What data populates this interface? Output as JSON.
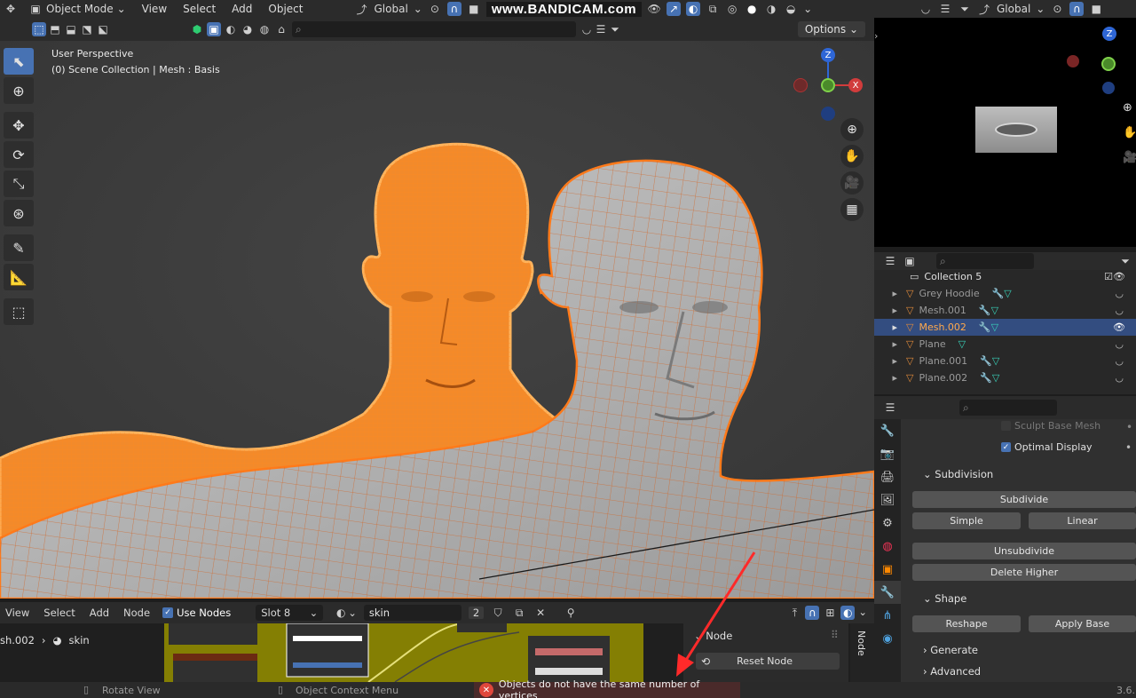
{
  "header": {
    "mode": "Object Mode",
    "menus": [
      "View",
      "Select",
      "Add",
      "Object"
    ],
    "orientation": "Global",
    "watermark": "www.BANDICAM.com",
    "options": "Options"
  },
  "viewport": {
    "perspective": "User Perspective",
    "collection_info": "(0) Scene Collection | Mesh : Basis",
    "gizmo": {
      "z": "Z",
      "x": "X"
    }
  },
  "right_header": {
    "orientation": "Global"
  },
  "outliner": {
    "collection": "Collection 5",
    "items": [
      {
        "name": "Grey Hoodie",
        "selected": false
      },
      {
        "name": "Mesh.001",
        "selected": false
      },
      {
        "name": "Mesh.002",
        "selected": true
      },
      {
        "name": "Plane",
        "selected": false
      },
      {
        "name": "Plane.001",
        "selected": false
      },
      {
        "name": "Plane.002",
        "selected": false
      }
    ]
  },
  "properties": {
    "sculpt_base_mesh": "Sculpt Base Mesh",
    "optimal_display": "Optimal Display",
    "subdivision": "Subdivision",
    "subdivide": "Subdivide",
    "simple": "Simple",
    "linear": "Linear",
    "unsubdivide": "Unsubdivide",
    "delete_higher": "Delete Higher",
    "shape": "Shape",
    "reshape": "Reshape",
    "apply_base": "Apply Base",
    "generate": "Generate",
    "advanced": "Advanced"
  },
  "node_editor": {
    "menus": [
      "View",
      "Select",
      "Add",
      "Node"
    ],
    "use_nodes": "Use Nodes",
    "slot": "Slot 8",
    "material": "skin",
    "users": "2",
    "breadcrumb_object": "sh.002",
    "breadcrumb_material": "skin",
    "node_panel_title": "Node",
    "reset_node": "Reset Node",
    "side_tab": "Node"
  },
  "status": {
    "rotate": "Rotate View",
    "context": "Object Context Menu",
    "error": "Objects do not have the same number of vertices",
    "version": "3.6."
  },
  "colors": {
    "accent": "#4772b3",
    "selected_orange": "#ffa94d",
    "wire_orange": "#ff8a1f",
    "error_red": "#c0392b"
  }
}
